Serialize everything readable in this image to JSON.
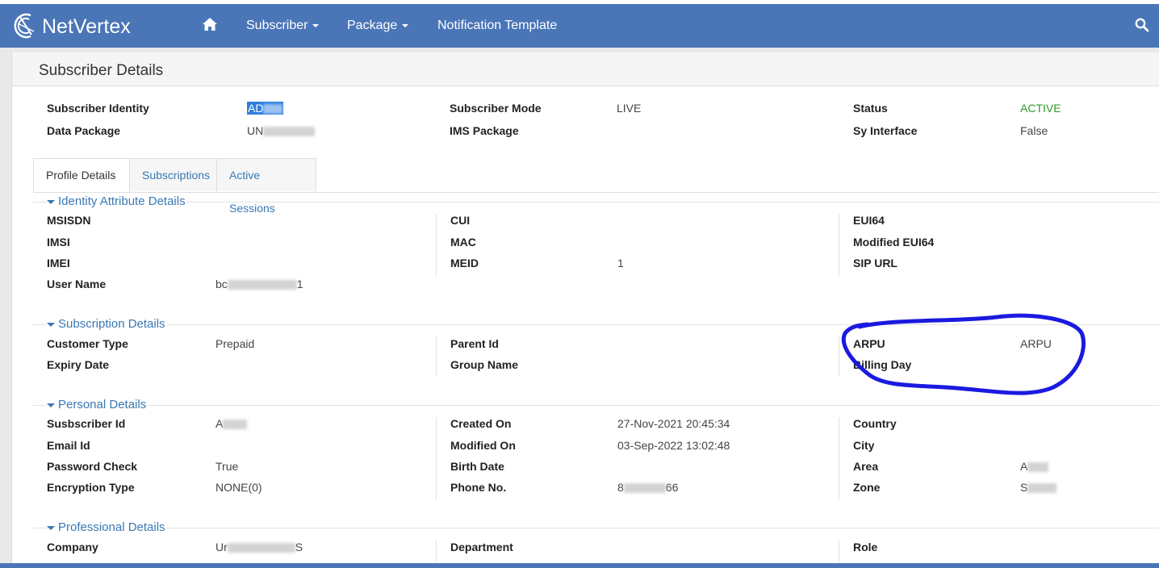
{
  "app": {
    "brand": "NetVertex"
  },
  "nav": {
    "subscriber": "Subscriber",
    "package": "Package",
    "notification": "Notification Template"
  },
  "page_title": "Subscriber Details",
  "summary": {
    "subscriber_identity_label": "Subscriber Identity",
    "subscriber_identity_value": "AD",
    "data_package_label": "Data Package",
    "data_package_value": "UN",
    "subscriber_mode_label": "Subscriber Mode",
    "subscriber_mode_value": "LIVE",
    "ims_package_label": "IMS Package",
    "status_label": "Status",
    "status_value": "ACTIVE",
    "sy_interface_label": "Sy Interface",
    "sy_interface_value": "False"
  },
  "tabs": [
    "Profile Details",
    "Subscriptions",
    "Active Sessions"
  ],
  "identity": {
    "title": "Identity Attribute Details",
    "msisdn": "MSISDN",
    "imsi": "IMSI",
    "imei": "IMEI",
    "user_name": "User Name",
    "user_name_value_prefix": "bc",
    "user_name_value_suffix": "1",
    "cui": "CUI",
    "mac": "MAC",
    "meid": "MEID",
    "meid_value": "1",
    "eui64": "EUI64",
    "modified_eui64": "Modified EUI64",
    "sip_url": "SIP URL"
  },
  "subscription": {
    "title": "Subscription Details",
    "customer_type": "Customer Type",
    "customer_type_value": "Prepaid",
    "expiry_date": "Expiry Date",
    "parent_id": "Parent Id",
    "group_name": "Group Name",
    "arpu": "ARPU",
    "arpu_value": "ARPU",
    "billing_day": "Billing Day"
  },
  "personal": {
    "title": "Personal Details",
    "subscriber_id": "Susbscriber Id",
    "subscriber_id_value": "A",
    "email_id": "Email Id",
    "password_check": "Password Check",
    "password_check_value": "True",
    "encryption_type": "Encryption Type",
    "encryption_type_value": "NONE(0)",
    "created_on": "Created On",
    "created_on_value": "27-Nov-2021 20:45:34",
    "modified_on": "Modified On",
    "modified_on_value": "03-Sep-2022 13:02:48",
    "birth_date": "Birth Date",
    "phone_no": "Phone No.",
    "phone_prefix": "8",
    "phone_suffix": "66",
    "country": "Country",
    "city": "City",
    "area": "Area",
    "area_value": "A",
    "zone": "Zone",
    "zone_value": "S"
  },
  "professional": {
    "title": "Professional Details",
    "company": "Company",
    "company_prefix": "Ur",
    "company_suffix": "S",
    "department": "Department",
    "role": "Role"
  },
  "colors": {
    "navbar": "#4a76b8",
    "link": "#3a78b3",
    "active": "#2a9a2a",
    "annotation": "#1a1ae0"
  }
}
